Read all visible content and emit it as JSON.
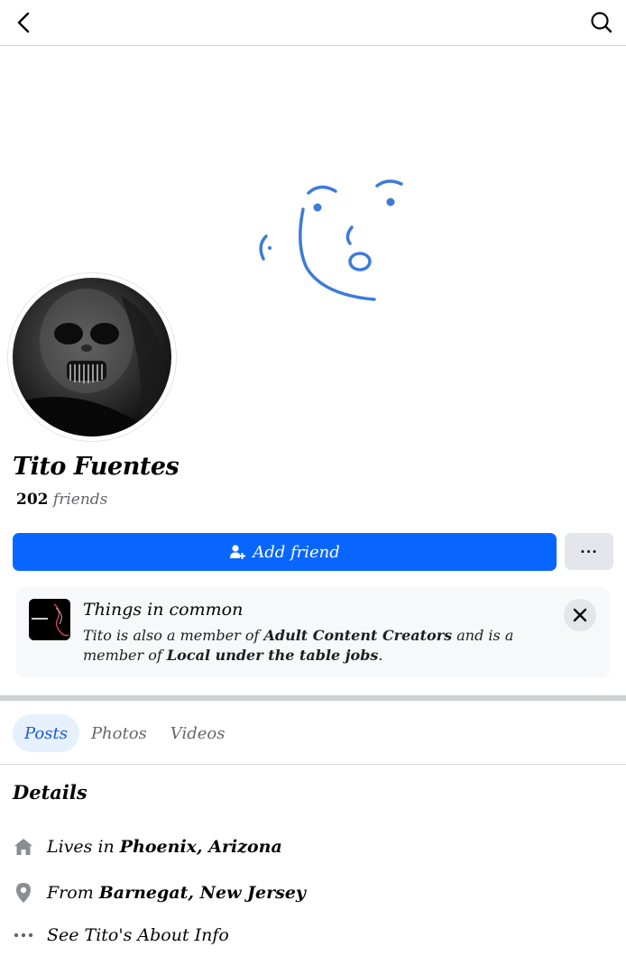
{
  "header": {
    "back_icon": "chevron-left-icon",
    "search_icon": "search-icon"
  },
  "profile": {
    "name": "Tito Fuentes",
    "friends_count": "202",
    "friends_label": "friends"
  },
  "actions": {
    "add_friend_label": "Add friend",
    "more_label": "···"
  },
  "things_in_common": {
    "title": "Things in common",
    "text_part1": "Tito is also a member of",
    "group1": "Adult Content Creators",
    "text_part2": "and is a member of",
    "group2": "Local under the table jobs",
    "text_end": "."
  },
  "tabs": [
    {
      "label": "Posts",
      "active": true
    },
    {
      "label": "Photos",
      "active": false
    },
    {
      "label": "Videos",
      "active": false
    }
  ],
  "details": {
    "title": "Details",
    "lives_prefix": "Lives in",
    "lives_place": "Phoenix, Arizona",
    "from_prefix": "From",
    "from_place": "Barnegat, New Jersey",
    "about_link": "See Tito's About Info"
  },
  "colors": {
    "accent": "#0866ff",
    "cover_doodle": "#3d7bd9"
  }
}
